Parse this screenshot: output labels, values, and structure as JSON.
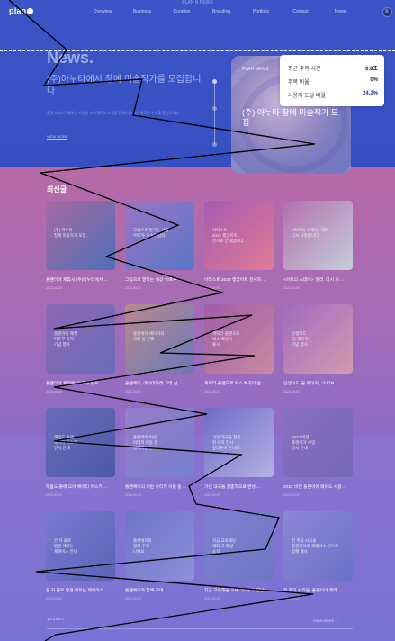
{
  "header": {
    "top_caption": "PLAN N NEWS",
    "logo": "plan",
    "nav": [
      "Overview",
      "Business",
      "Curation",
      "Branding",
      "Portfolio",
      "Contact",
      "News"
    ],
    "account_glyph": "≡"
  },
  "hero": {
    "title": "News.",
    "subtitle": "(주)아누타에서 창에 미술작가를 모집합니다",
    "description": "플랜 A에서 진행하는 다양한 프로젝트와 소식을 전해드립니다. 새로운 소식을 확인하세요.",
    "more": "VIEW MORE",
    "card": {
      "tag": "PLAN NEWS",
      "title": "(주) 아누타 창에 미술작가 모집"
    }
  },
  "tooltip": {
    "rows": [
      {
        "label": "평균 주목 시간",
        "value": "0.8초"
      },
      {
        "label": "주목 비율",
        "value": "0%"
      },
      {
        "label": "사용자 도달 비율",
        "value": "24.2%"
      }
    ]
  },
  "section": {
    "title": "최신글",
    "items": [
      {
        "caption": "플랜이아 제휴사 (주)아누타에서 ...",
        "date": "2023.00.00",
        "thumb": "(주) 아누타\n창에 미술작가 모집"
      },
      {
        "caption": "그림으로 말하는 세상 '아트투 ...",
        "date": "2023.00.00",
        "thumb": "그림으로 말하는 세상\n'아트투 미술전람회'"
      },
      {
        "caption": "아티스트 2022 행궁아트 전시회 ...",
        "date": "2023.00.00",
        "thumb": "아티스트\n2022 행궁아트\n전시회 안내합니다"
      },
      {
        "caption": "<아트의 스테이> '갤러, 다시 시 ...",
        "date": "2023.00.00",
        "thumb": "<아트의 스테이> 대리\n다시 시작합니다"
      },
      {
        "caption": "플랜이아 제작에 \"아트부 유지 ...",
        "date": "2023.00.00",
        "thumb": "플랜이아 제작\n아트부 유지\n기념 행사"
      },
      {
        "caption": "플랜에이, 에이아자레 그레 실 ...",
        "date": "2023.00.00",
        "thumb": "플랜에이 에이아자\n그레 실 진행"
      },
      {
        "caption": "캐릭터-플랜으로 박스 빼곡이 살 ...",
        "date": "2023.00.00",
        "thumb": "캐릭터-플랜으로\n박스 빼곡이\n출시"
      },
      {
        "caption": "인생이드 '블 메이커', '스티브 ...",
        "date": "2023.00.00",
        "thumb": "인생이드\n'블 메이커'\n기념 행사"
      },
      {
        "caption": "해봄도 돌에 모아 에이티 어스키 ...",
        "date": "2023.00.00",
        "thumb": "해봄도 돌에\n에이티 어스키\n전시 안내"
      },
      {
        "caption": "플랜에이의 어린 아티저 이들 동 ...",
        "date": "2023.00.00",
        "thumb": "플랜에이 어린\n아티저 이들 동\n함께하는 전시"
      },
      {
        "caption": "가인 대극을 정종적으로 완성 ...",
        "date": "2023.00.00",
        "thumb": "가인 대극을 정종\n한 이미 전시\n앞다투어 만나다"
      },
      {
        "caption": "2022 비전 플랜이아 레이도 사랑 ...",
        "date": "2023.00.00",
        "thumb": "2022 비전\n플랜이아 사랑\n전시 안내"
      },
      {
        "caption": "은 자 물로 발견 예표는 제에이스 ...",
        "date": "2023.00.00",
        "thumb": "은 자 물로\n발견 예표는\n제에이스 안내"
      },
      {
        "caption": "플랜에이와 함께 꾸며 ...",
        "date": "2023.00.00",
        "thumb": "플랜에이와\n함께 꾸며\n나눠요"
      },
      {
        "caption": "지금 교육해당 교육, '벽화 그 웹방' ...",
        "date": "2023.00.00",
        "thumb": "지금 교육해당\n벽화 그 웹방\n소식"
      },
      {
        "caption": "전 주의 시작을, 플랜이아 제레 ...",
        "date": "2023.00.00",
        "thumb": "전 주의 시작을\n플랜이아의 제레이스 인으로\n함께 행사"
      }
    ]
  },
  "footer": {
    "left": "1 2 3 4 5  >",
    "right": "VIEW MORE  →"
  },
  "colors": {
    "hero_bg": "#3b55c8",
    "mid_bg": "#b86aa6",
    "low_bg": "#7a72d6",
    "tooltip_bg": "#ffffff"
  }
}
